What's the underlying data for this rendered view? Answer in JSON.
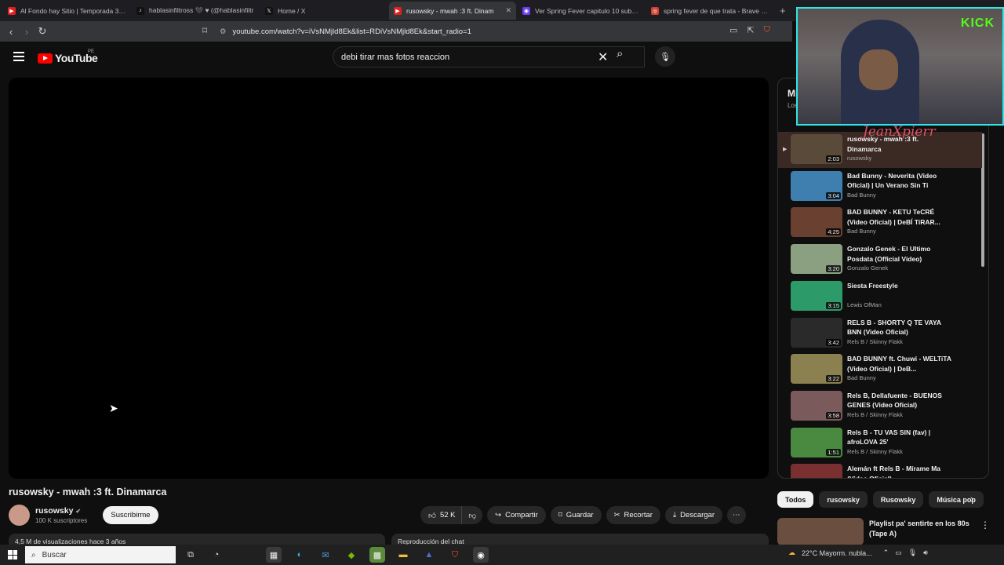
{
  "browser": {
    "tabs": [
      {
        "label": "Al Fondo hay Sitio | Temporada 3 | Ca",
        "fav": "#e02020",
        "glyph": "▶"
      },
      {
        "label": "hablasinfiltross 🖤 ♥ (@hablasinfiltr",
        "fav": "#111",
        "glyph": "♪"
      },
      {
        "label": "Home / X",
        "fav": "#111",
        "glyph": "𝕏"
      },
      {
        "label": "rusowsky - mwah :3 ft. Dinam",
        "fav": "#e02020",
        "glyph": "▶",
        "active": true
      },
      {
        "label": "Ver Spring Fever capitulo 10 sub esp",
        "fav": "#6a3ef0",
        "glyph": "◉"
      },
      {
        "label": "spring fever de que trata - Brave Sea",
        "fav": "#d04030",
        "glyph": "◎"
      }
    ],
    "url": "youtube.com/watch?v=iVsNMjld8Ek&list=RDiVsNMjld8Ek&start_radio=1"
  },
  "header": {
    "logo": "YouTube",
    "country": "PE",
    "search_value": "debi tirar mas fotos reaccion"
  },
  "video": {
    "title": "rusowsky - mwah :3 ft. Dinamarca",
    "channel": "rusowsky",
    "subscribers": "100 K suscriptores",
    "subscribe_label": "Suscribirme",
    "likes": "52 K",
    "share": "Compartir",
    "save": "Guardar",
    "clip": "Recortar",
    "download": "Descargar",
    "views_partial": "4,5 M de visualizaciones  hace 3 años",
    "chat_replay": "Reproducción del chat"
  },
  "playlist": {
    "title": "Mix",
    "subtitle": "Los",
    "items": [
      {
        "title": "rusowsky - mwah :3 ft. Dinamarca",
        "channel": "rusowsky",
        "duration": "2:03",
        "color": "#5a4a3a",
        "active": true
      },
      {
        "title": "Bad Bunny - Neverita (Video Oficial) | Un Verano Sin Ti",
        "channel": "Bad Bunny",
        "duration": "3:04",
        "color": "#3f7fb0"
      },
      {
        "title": "BAD BUNNY - KETU TeCRÉ (Video Oficial) | DeBÍ TiRAR...",
        "channel": "Bad Bunny",
        "duration": "4:25",
        "color": "#6a4030"
      },
      {
        "title": "Gonzalo Genek - El Ultimo Posdata (Official Video)",
        "channel": "Gonzalo Genek",
        "duration": "3:20",
        "color": "#8aa080"
      },
      {
        "title": "Siesta Freestyle",
        "channel": "Lewis OfMan",
        "duration": "3:15",
        "color": "#2d9a6a"
      },
      {
        "title": "RELS B - SHORTY Q TE VAYA BNN (Video Oficial)",
        "channel": "Rels B / Skinny Flakk",
        "duration": "3:42",
        "color": "#2a2a2a"
      },
      {
        "title": "BAD BUNNY ft. Chuwi - WELTiTA (Video Oficial) | DeB...",
        "channel": "Bad Bunny",
        "duration": "3:22",
        "color": "#8a8050"
      },
      {
        "title": "Rels B, Dellafuente - BUENOS GENES (Video Oficial)",
        "channel": "Rels B / Skinny Flakk",
        "duration": "3:58",
        "color": "#7a5a5a"
      },
      {
        "title": "Rels B - TU VAS SIN (fav) | afroLOVA 25'",
        "channel": "Rels B / Skinny Flakk",
        "duration": "1:51",
        "color": "#4a8a40"
      },
      {
        "title": "Alemán ft Rels B - Mírame Ma (Video Oficial)",
        "channel": "",
        "duration": "",
        "color": "#7a3030"
      }
    ]
  },
  "chips": [
    "Todos",
    "rusowsky",
    "Rusowsky",
    "Música pop"
  ],
  "recommended": {
    "title": "Playlist pa' sentirte en los 80s (Tape A)"
  },
  "overlay": {
    "platform": "KICK",
    "streamer": "JeanXpierr"
  },
  "taskbar": {
    "search_placeholder": "Buscar",
    "weather": "22°C  Mayorm. nubla..."
  }
}
